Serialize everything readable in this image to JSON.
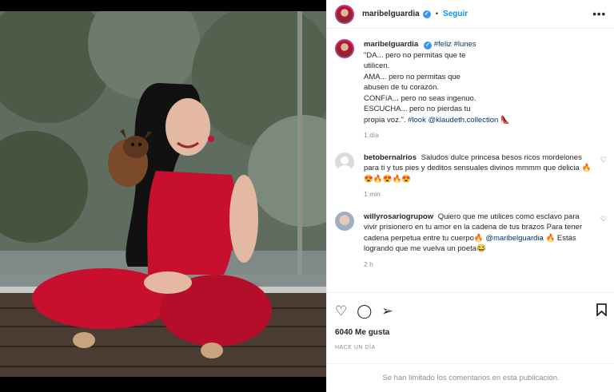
{
  "post": {
    "username": "maribelguardia",
    "follow_label": "Seguir",
    "more_label": "•••"
  },
  "caption": {
    "username": "maribelguardia",
    "hashtags": "#feliz #lunes",
    "lines": [
      "\"DA... pero no permitas que te",
      "utilicen.",
      "AMA... pero no permitas que",
      "abusen de tu corazón.",
      "CONFíA... pero no seas ingenuo.",
      "ESCUCHA... pero no pierdas tu",
      "propia voz.\"."
    ],
    "end_tags": "#look @klaudeth.collection",
    "end_emoji": "👠",
    "time": "1 día"
  },
  "comments": [
    {
      "username": "betobernalrios",
      "text": "Saludos dulce princesa besos ricos mordelones para ti y tus pies y deditos sensuales divinos mmmm que delicia 🔥😍🔥😍🔥😍",
      "time": "1 min"
    },
    {
      "username": "willyrosariogrupow",
      "text_before": "Quiero que me utilices como esclavo para vivir prisionero en tu amor en la cadena de tus brazos Para tener cadena perpetua entre tu cuerpo🔥",
      "mention": "@maribelguardia",
      "text_after": "🔥 Estás logrando que me vuelva un poeta😂",
      "time": "2 h"
    }
  ],
  "actions": {
    "likes": "6040 Me gusta",
    "posted_ago": "HACE UN DÍA",
    "comments_limited": "Se han limitado los comentarios en esta publicación."
  }
}
